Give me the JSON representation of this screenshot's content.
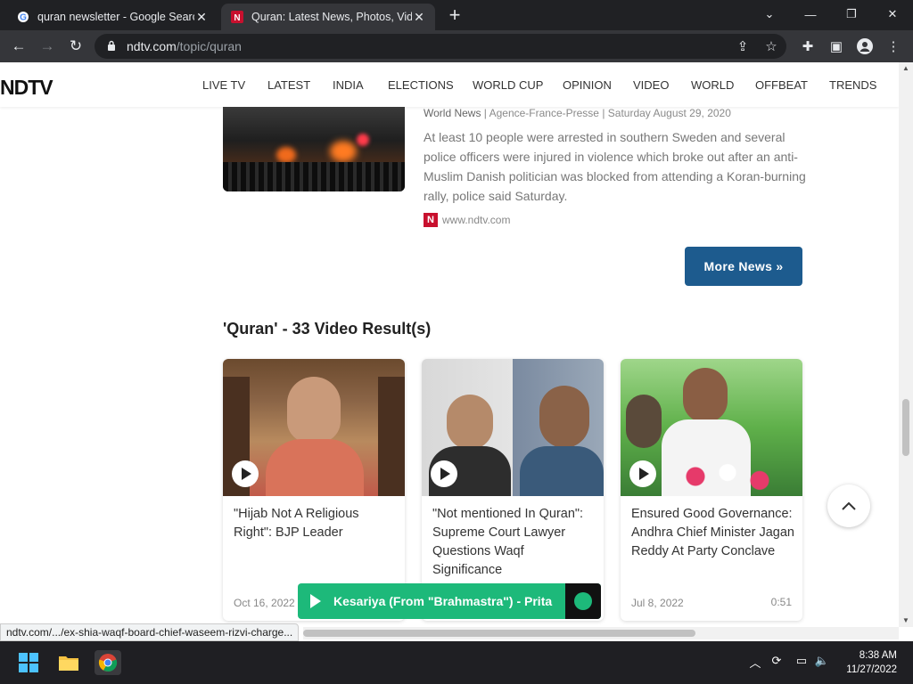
{
  "browser": {
    "tabs": [
      {
        "title": "quran newsletter - Google Search",
        "favicon": "google-g-icon",
        "active": false
      },
      {
        "title": "Quran: Latest News, Photos, Videos",
        "favicon": "ndtv-n-icon",
        "active": true
      }
    ],
    "url_host": "ndtv.com",
    "url_path": "/topic/quran"
  },
  "site": {
    "logo": "NDTV",
    "nav": [
      "LIVE TV",
      "LATEST",
      "INDIA",
      "ELECTIONS",
      "WORLD CUP",
      "OPINION",
      "VIDEO",
      "WORLD",
      "OFFBEAT",
      "TRENDS"
    ]
  },
  "article": {
    "category": "World News",
    "agency": "Agence-France-Presse",
    "date": "Saturday August 29, 2020",
    "summary": "At least 10 people were arrested in southern Sweden and several police officers were injured in violence which broke out after an anti-Muslim Danish politician was blocked from attending a Koran-burning rally, police said Saturday.",
    "source": "www.ndtv.com",
    "source_badge": "N"
  },
  "more_news_label": "More News »",
  "video_section_title": "'Quran' - 33 Video Result(s)",
  "videos": [
    {
      "title": "\"Hijab Not A Religious Right\": BJP Leader",
      "date": "Oct 16, 2022",
      "duration": ""
    },
    {
      "title": "\"Not mentioned In Quran\": Supreme Court Lawyer Questions Waqf Significance",
      "date": "",
      "duration": ""
    },
    {
      "title": "Ensured Good Governance: Andhra Chief Minister Jagan Reddy At Party Conclave",
      "date": "Jul 8, 2022",
      "duration": "0:51"
    }
  ],
  "music_player": {
    "text": "Kesariya (From \"Brahmastra\") - Pritam"
  },
  "status_url": "ndtv.com/.../ex-shia-waqf-board-chief-waseem-rizvi-charge...",
  "taskbar": {
    "time": "8:38 AM",
    "date": "11/27/2022"
  },
  "colors": {
    "button_blue": "#1d5b8e",
    "music_green": "#1db97a",
    "ndtv_red": "#c8102e"
  }
}
